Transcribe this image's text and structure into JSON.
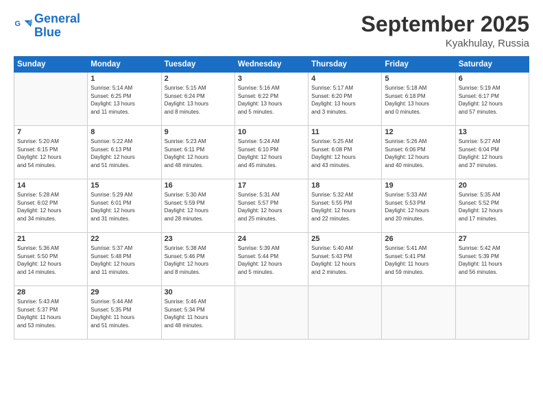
{
  "header": {
    "logo_line1": "General",
    "logo_line2": "Blue",
    "month_title": "September 2025",
    "location": "Kyakhulay, Russia"
  },
  "weekdays": [
    "Sunday",
    "Monday",
    "Tuesday",
    "Wednesday",
    "Thursday",
    "Friday",
    "Saturday"
  ],
  "weeks": [
    [
      {
        "day": "",
        "info": ""
      },
      {
        "day": "1",
        "info": "Sunrise: 5:14 AM\nSunset: 6:25 PM\nDaylight: 13 hours\nand 11 minutes."
      },
      {
        "day": "2",
        "info": "Sunrise: 5:15 AM\nSunset: 6:24 PM\nDaylight: 13 hours\nand 8 minutes."
      },
      {
        "day": "3",
        "info": "Sunrise: 5:16 AM\nSunset: 6:22 PM\nDaylight: 13 hours\nand 5 minutes."
      },
      {
        "day": "4",
        "info": "Sunrise: 5:17 AM\nSunset: 6:20 PM\nDaylight: 13 hours\nand 3 minutes."
      },
      {
        "day": "5",
        "info": "Sunrise: 5:18 AM\nSunset: 6:18 PM\nDaylight: 13 hours\nand 0 minutes."
      },
      {
        "day": "6",
        "info": "Sunrise: 5:19 AM\nSunset: 6:17 PM\nDaylight: 12 hours\nand 57 minutes."
      }
    ],
    [
      {
        "day": "7",
        "info": "Sunrise: 5:20 AM\nSunset: 6:15 PM\nDaylight: 12 hours\nand 54 minutes."
      },
      {
        "day": "8",
        "info": "Sunrise: 5:22 AM\nSunset: 6:13 PM\nDaylight: 12 hours\nand 51 minutes."
      },
      {
        "day": "9",
        "info": "Sunrise: 5:23 AM\nSunset: 6:11 PM\nDaylight: 12 hours\nand 48 minutes."
      },
      {
        "day": "10",
        "info": "Sunrise: 5:24 AM\nSunset: 6:10 PM\nDaylight: 12 hours\nand 45 minutes."
      },
      {
        "day": "11",
        "info": "Sunrise: 5:25 AM\nSunset: 6:08 PM\nDaylight: 12 hours\nand 43 minutes."
      },
      {
        "day": "12",
        "info": "Sunrise: 5:26 AM\nSunset: 6:06 PM\nDaylight: 12 hours\nand 40 minutes."
      },
      {
        "day": "13",
        "info": "Sunrise: 5:27 AM\nSunset: 6:04 PM\nDaylight: 12 hours\nand 37 minutes."
      }
    ],
    [
      {
        "day": "14",
        "info": "Sunrise: 5:28 AM\nSunset: 6:02 PM\nDaylight: 12 hours\nand 34 minutes."
      },
      {
        "day": "15",
        "info": "Sunrise: 5:29 AM\nSunset: 6:01 PM\nDaylight: 12 hours\nand 31 minutes."
      },
      {
        "day": "16",
        "info": "Sunrise: 5:30 AM\nSunset: 5:59 PM\nDaylight: 12 hours\nand 28 minutes."
      },
      {
        "day": "17",
        "info": "Sunrise: 5:31 AM\nSunset: 5:57 PM\nDaylight: 12 hours\nand 25 minutes."
      },
      {
        "day": "18",
        "info": "Sunrise: 5:32 AM\nSunset: 5:55 PM\nDaylight: 12 hours\nand 22 minutes."
      },
      {
        "day": "19",
        "info": "Sunrise: 5:33 AM\nSunset: 5:53 PM\nDaylight: 12 hours\nand 20 minutes."
      },
      {
        "day": "20",
        "info": "Sunrise: 5:35 AM\nSunset: 5:52 PM\nDaylight: 12 hours\nand 17 minutes."
      }
    ],
    [
      {
        "day": "21",
        "info": "Sunrise: 5:36 AM\nSunset: 5:50 PM\nDaylight: 12 hours\nand 14 minutes."
      },
      {
        "day": "22",
        "info": "Sunrise: 5:37 AM\nSunset: 5:48 PM\nDaylight: 12 hours\nand 11 minutes."
      },
      {
        "day": "23",
        "info": "Sunrise: 5:38 AM\nSunset: 5:46 PM\nDaylight: 12 hours\nand 8 minutes."
      },
      {
        "day": "24",
        "info": "Sunrise: 5:39 AM\nSunset: 5:44 PM\nDaylight: 12 hours\nand 5 minutes."
      },
      {
        "day": "25",
        "info": "Sunrise: 5:40 AM\nSunset: 5:43 PM\nDaylight: 12 hours\nand 2 minutes."
      },
      {
        "day": "26",
        "info": "Sunrise: 5:41 AM\nSunset: 5:41 PM\nDaylight: 11 hours\nand 59 minutes."
      },
      {
        "day": "27",
        "info": "Sunrise: 5:42 AM\nSunset: 5:39 PM\nDaylight: 11 hours\nand 56 minutes."
      }
    ],
    [
      {
        "day": "28",
        "info": "Sunrise: 5:43 AM\nSunset: 5:37 PM\nDaylight: 11 hours\nand 53 minutes."
      },
      {
        "day": "29",
        "info": "Sunrise: 5:44 AM\nSunset: 5:35 PM\nDaylight: 11 hours\nand 51 minutes."
      },
      {
        "day": "30",
        "info": "Sunrise: 5:46 AM\nSunset: 5:34 PM\nDaylight: 11 hours\nand 48 minutes."
      },
      {
        "day": "",
        "info": ""
      },
      {
        "day": "",
        "info": ""
      },
      {
        "day": "",
        "info": ""
      },
      {
        "day": "",
        "info": ""
      }
    ]
  ]
}
